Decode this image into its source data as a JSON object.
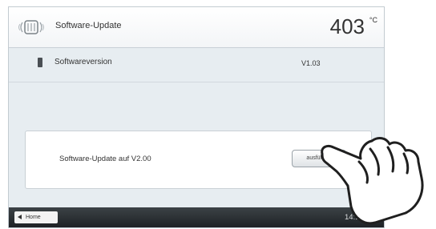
{
  "header": {
    "title": "Software-Update",
    "temperature": "403",
    "temperature_unit": "°C",
    "furnace_icon": "furnace-icon"
  },
  "software_version": {
    "label": "Softwareversion",
    "value": "V1.03",
    "icon": "chip-icon"
  },
  "update": {
    "label": "Software-Update auf V2.00",
    "button_label": "ausführen"
  },
  "footer": {
    "home_label": "Home",
    "time": "14:16:01"
  },
  "colors": {
    "background": "#e7edf1",
    "footer": "#2a2f33",
    "panel": "#ffffff"
  }
}
